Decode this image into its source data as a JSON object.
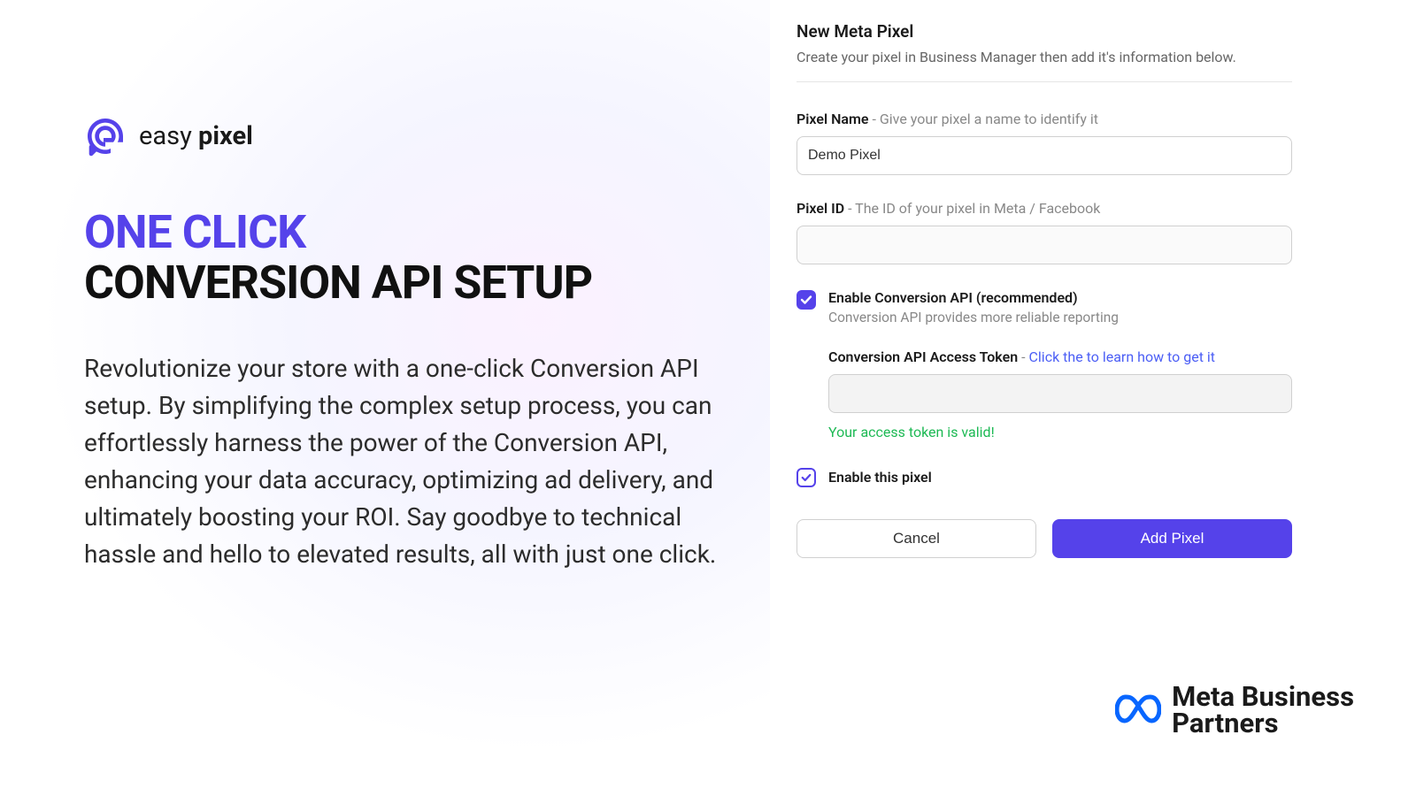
{
  "brand": {
    "logo_word1": "easy",
    "logo_word2": "pixel"
  },
  "hero": {
    "headline_1": "ONE CLICK",
    "headline_2": "CONVERSION API SETUP",
    "body": "Revolutionize your store with a one-click Conversion API setup. By simplifying the complex setup process, you can effortlessly harness the power of the Conversion API, enhancing your data accuracy, optimizing ad delivery, and ultimately boosting your ROI. Say goodbye to technical hassle and hello to elevated results, all with just one click."
  },
  "form": {
    "title": "New Meta Pixel",
    "subtitle": "Create your pixel in Business Manager then add it's information below.",
    "pixel_name_label": "Pixel Name",
    "pixel_name_hint": " - Give your pixel a name to identify it",
    "pixel_name_value": "Demo Pixel",
    "pixel_id_label": "Pixel ID",
    "pixel_id_hint": " - The ID of your pixel in Meta / Facebook",
    "pixel_id_value": "",
    "capi_enable_label": "Enable Conversion API (recommended)",
    "capi_enable_sub": "Conversion API provides more reliable reporting",
    "capi_token_label": "Conversion API Access Token",
    "capi_token_hint": " - ",
    "capi_token_link": "Click the to learn how to get it",
    "capi_token_value": "",
    "token_valid_msg": "Your access token is valid!",
    "enable_pixel_label": "Enable this pixel",
    "cancel": "Cancel",
    "add_pixel": "Add Pixel"
  },
  "footer": {
    "meta_line1": "Meta Business",
    "meta_line2": "Partners"
  }
}
